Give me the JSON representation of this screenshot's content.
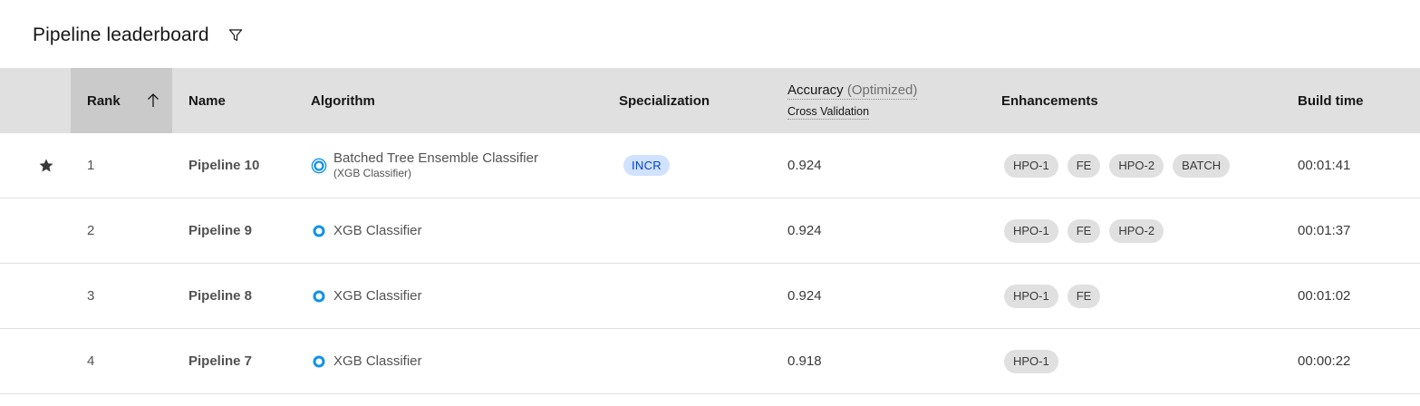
{
  "header": {
    "title": "Pipeline leaderboard",
    "filter_icon": "filter-icon"
  },
  "columns": {
    "rank": "Rank",
    "name": "Name",
    "algorithm": "Algorithm",
    "specialization": "Specialization",
    "accuracy": "Accuracy",
    "accuracy_qualifier": "(Optimized)",
    "accuracy_sub": "Cross Validation",
    "enhancements": "Enhancements",
    "build_time": "Build time"
  },
  "sort": {
    "column": "rank",
    "direction": "ascending",
    "icon": "arrow-up-icon"
  },
  "rows": [
    {
      "starred": true,
      "rank": "1",
      "name": "Pipeline 10",
      "algorithm": "Batched Tree Ensemble Classifier",
      "algorithm_sub": "(XGB Classifier)",
      "specialization": "INCR",
      "accuracy": "0.924",
      "enhancements": [
        "HPO-1",
        "FE",
        "HPO-2",
        "BATCH"
      ],
      "build_time": "00:01:41"
    },
    {
      "starred": false,
      "rank": "2",
      "name": "Pipeline 9",
      "algorithm": "XGB Classifier",
      "algorithm_sub": "",
      "specialization": "",
      "accuracy": "0.924",
      "enhancements": [
        "HPO-1",
        "FE",
        "HPO-2"
      ],
      "build_time": "00:01:37"
    },
    {
      "starred": false,
      "rank": "3",
      "name": "Pipeline 8",
      "algorithm": "XGB Classifier",
      "algorithm_sub": "",
      "specialization": "",
      "accuracy": "0.924",
      "enhancements": [
        "HPO-1",
        "FE"
      ],
      "build_time": "00:01:02"
    },
    {
      "starred": false,
      "rank": "4",
      "name": "Pipeline 7",
      "algorithm": "XGB Classifier",
      "algorithm_sub": "",
      "specialization": "",
      "accuracy": "0.918",
      "enhancements": [
        "HPO-1"
      ],
      "build_time": "00:00:22"
    }
  ],
  "colors": {
    "header_bg": "#e0e0e0",
    "sorted_header_bg": "#cacaca",
    "accent_blue": "#1192e8",
    "incr_tag_bg": "#d0e2ff",
    "incr_tag_text": "#0043ce",
    "chip_bg": "#e0e0e0"
  }
}
